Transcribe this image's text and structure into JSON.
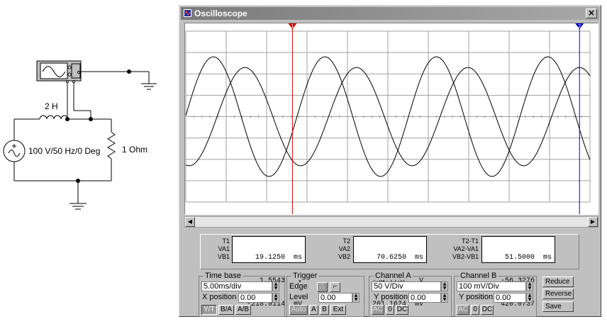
{
  "schematic": {
    "inductor_label": "2 H",
    "source_label": "100 V/50 Hz/0 Deg",
    "resistor_label": "1  Ohm"
  },
  "window": {
    "title": "Oscilloscope",
    "close_glyph": "×"
  },
  "cursors": {
    "t1_marker": "1",
    "t2_marker": "2"
  },
  "readout": {
    "t1": {
      "labels": [
        "T1",
        "VA1",
        "VB1"
      ],
      "values": [
        "19.1250  ms",
        "1.5543   V",
        "-218.9114  mV"
      ]
    },
    "t2": {
      "labels": [
        "T2",
        "VA2",
        "VB2"
      ],
      "values": [
        "70.6250  ms",
        "-54.7732   V",
        "201.1624  mV"
      ]
    },
    "diff": {
      "labels": [
        "T2-T1",
        "VA2-VA1",
        "VB2-VB1"
      ],
      "values": [
        "51.5000  ms",
        "-56.3276   V",
        "420.0737  mV"
      ]
    }
  },
  "timebase": {
    "title": "Time base",
    "scale": "5.00ms/div",
    "xpos_label": "X position",
    "xpos": "0.00",
    "buttons": [
      "Y/T",
      "B/A",
      "A/B"
    ]
  },
  "trigger": {
    "title": "Trigger",
    "edge_label": "Edge",
    "level_label": "Level",
    "level": "0.00",
    "buttons": [
      "Auto",
      "A",
      "B",
      "Ext"
    ]
  },
  "channel_a": {
    "title": "Channel A",
    "scale": "50  V/Div",
    "ypos_label": "Y position",
    "ypos": "0.00",
    "buttons": [
      "AC",
      "0",
      "DC"
    ]
  },
  "channel_b": {
    "title": "Channel B",
    "scale": "100 mV/Div",
    "ypos_label": "Y position",
    "ypos": "0.00",
    "buttons": [
      "AC",
      "0",
      "DC"
    ]
  },
  "side_buttons": [
    "Reduce",
    "Reverse",
    "Save"
  ],
  "chart_data": {
    "type": "line",
    "x_range_ms": [
      0,
      72.5
    ],
    "channel_a_vpd": 50,
    "channel_b_mvpd": 100,
    "series": [
      {
        "frequency_hz": 50,
        "amplitude_div": 2.8,
        "phase_deg": 1.0
      },
      {
        "frequency_hz": 50,
        "amplitude_div": 2.3,
        "phase_deg": -101
      }
    ],
    "cursor_t1_ms": 19.125,
    "cursor_t2_ms": 70.625,
    "grid": true,
    "colors": {
      "trace": "#000000",
      "cursor1": "#d40000",
      "cursor2": "#0000c8",
      "grid": "#a0a0a0"
    }
  }
}
